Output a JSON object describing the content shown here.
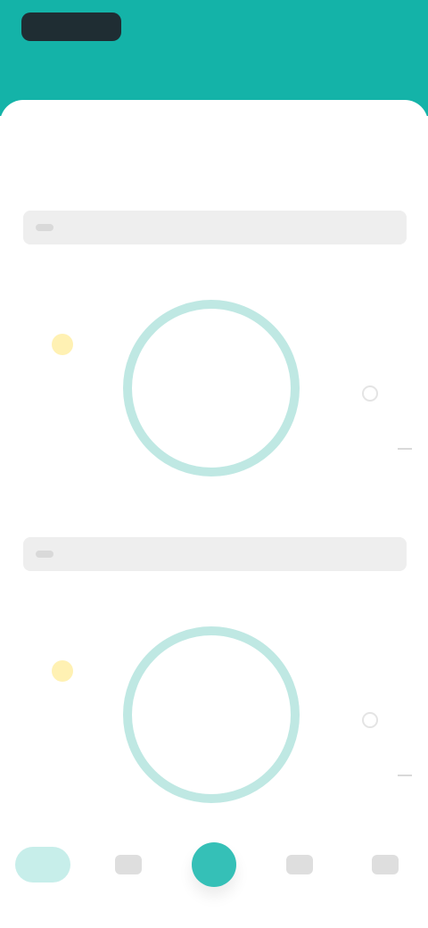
{
  "header": {
    "logo_text": "",
    "action_text": "",
    "subline": ""
  },
  "tabs": [
    {
      "label": ""
    },
    {
      "label": ""
    },
    {
      "label": ""
    }
  ],
  "cards": [
    {
      "title": "",
      "subtitle": "",
      "label": "",
      "ring_value": "",
      "ring_caption": "",
      "left_note": "",
      "right_note": ""
    },
    {
      "title": "",
      "subtitle": "",
      "label": "",
      "ring_value": "",
      "ring_caption": "",
      "left_note": "",
      "right_note": ""
    }
  ],
  "colors": {
    "header": "#14b3a8",
    "ring": "#bfe8e3",
    "accent": "#35c0b7",
    "weather_icon": "#fff1b3"
  },
  "icons": {
    "weather": "sun-icon",
    "nav_center": "center-action-icon"
  },
  "nav": [
    {
      "name": "home"
    },
    {
      "name": "calendar"
    },
    {
      "name": "center-action"
    },
    {
      "name": "records"
    },
    {
      "name": "profile"
    }
  ]
}
